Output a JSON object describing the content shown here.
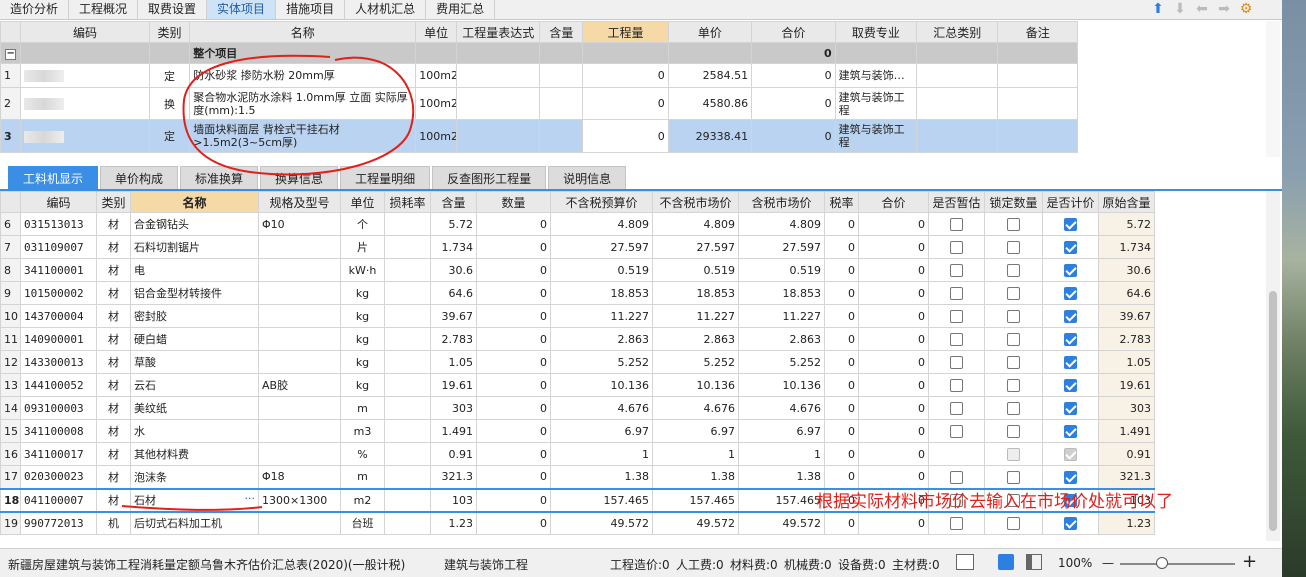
{
  "top_tabs": [
    "造价分析",
    "工程概况",
    "取费设置",
    "实体项目",
    "措施项目",
    "人材机汇总",
    "费用汇总"
  ],
  "top_active_tab": 3,
  "upper_table": {
    "headers": [
      "编码",
      "类别",
      "名称",
      "单位",
      "工程量表达式",
      "含量",
      "工程量",
      "单价",
      "合价",
      "取费专业",
      "汇总类别",
      "备注"
    ],
    "group_row": {
      "name": "整个项目",
      "total": "0"
    },
    "rows": [
      {
        "no": "1",
        "type": "定",
        "name": "防水砂浆 掺防水粉 20mm厚",
        "unit": "100m2",
        "qty": "0",
        "price": "2584.51",
        "amount": "0",
        "fee": "建筑与装饰…"
      },
      {
        "no": "2",
        "type": "换",
        "name": "聚合物水泥防水涂料 1.0mm厚 立面 实际厚度(mm):1.5",
        "unit": "100m2",
        "qty": "0",
        "price": "4580.86",
        "amount": "0",
        "fee": "建筑与装饰工程"
      },
      {
        "no": "3",
        "type": "定",
        "name": "墙面块料面层 背栓式干挂石材 >1.5m2(3~5cm厚)",
        "unit": "100m2",
        "qty": "0",
        "price": "29338.41",
        "amount": "0",
        "fee": "建筑与装饰工程"
      }
    ]
  },
  "lower_tabs": [
    "工料机显示",
    "单价构成",
    "标准换算",
    "换算信息",
    "工程量明细",
    "反查图形工程量",
    "说明信息"
  ],
  "lower_active_tab": 0,
  "lower_table": {
    "headers": [
      "编码",
      "类别",
      "名称",
      "规格及型号",
      "单位",
      "损耗率",
      "含量",
      "数量",
      "不含税预算价",
      "不含税市场价",
      "含税市场价",
      "税率",
      "合价",
      "是否暂估",
      "锁定数量",
      "是否计价",
      "原始含量"
    ],
    "rows": [
      {
        "no": "6",
        "code": "031513013",
        "type": "材",
        "name": "合金钢钻头",
        "spec": "Φ10",
        "unit": "个",
        "content": "5.72",
        "qty": "0",
        "budget": "4.809",
        "market": "4.809",
        "taxed": "4.809",
        "rate": "0",
        "amount": "0",
        "est": false,
        "lock": false,
        "price": true,
        "lockdis": false,
        "orig": "5.72"
      },
      {
        "no": "7",
        "code": "031109007",
        "type": "材",
        "name": "石料切割锯片",
        "spec": "",
        "unit": "片",
        "content": "1.734",
        "qty": "0",
        "budget": "27.597",
        "market": "27.597",
        "taxed": "27.597",
        "rate": "0",
        "amount": "0",
        "est": false,
        "lock": false,
        "price": true,
        "lockdis": false,
        "orig": "1.734"
      },
      {
        "no": "8",
        "code": "341100001",
        "type": "材",
        "name": "电",
        "spec": "",
        "unit": "kW·h",
        "content": "30.6",
        "qty": "0",
        "budget": "0.519",
        "market": "0.519",
        "taxed": "0.519",
        "rate": "0",
        "amount": "0",
        "est": false,
        "lock": false,
        "price": true,
        "lockdis": false,
        "orig": "30.6"
      },
      {
        "no": "9",
        "code": "101500002",
        "type": "材",
        "name": "铝合金型材转接件",
        "spec": "",
        "unit": "kg",
        "content": "64.6",
        "qty": "0",
        "budget": "18.853",
        "market": "18.853",
        "taxed": "18.853",
        "rate": "0",
        "amount": "0",
        "est": false,
        "lock": false,
        "price": true,
        "lockdis": false,
        "orig": "64.6"
      },
      {
        "no": "10",
        "code": "143700004",
        "type": "材",
        "name": "密封胶",
        "spec": "",
        "unit": "kg",
        "content": "39.67",
        "qty": "0",
        "budget": "11.227",
        "market": "11.227",
        "taxed": "11.227",
        "rate": "0",
        "amount": "0",
        "est": false,
        "lock": false,
        "price": true,
        "lockdis": false,
        "orig": "39.67"
      },
      {
        "no": "11",
        "code": "140900001",
        "type": "材",
        "name": "硬白蜡",
        "spec": "",
        "unit": "kg",
        "content": "2.783",
        "qty": "0",
        "budget": "2.863",
        "market": "2.863",
        "taxed": "2.863",
        "rate": "0",
        "amount": "0",
        "est": false,
        "lock": false,
        "price": true,
        "lockdis": false,
        "orig": "2.783"
      },
      {
        "no": "12",
        "code": "143300013",
        "type": "材",
        "name": "草酸",
        "spec": "",
        "unit": "kg",
        "content": "1.05",
        "qty": "0",
        "budget": "5.252",
        "market": "5.252",
        "taxed": "5.252",
        "rate": "0",
        "amount": "0",
        "est": false,
        "lock": false,
        "price": true,
        "lockdis": false,
        "orig": "1.05"
      },
      {
        "no": "13",
        "code": "144100052",
        "type": "材",
        "name": "云石",
        "spec": "AB胶",
        "unit": "kg",
        "content": "19.61",
        "qty": "0",
        "budget": "10.136",
        "market": "10.136",
        "taxed": "10.136",
        "rate": "0",
        "amount": "0",
        "est": false,
        "lock": false,
        "price": true,
        "lockdis": false,
        "orig": "19.61"
      },
      {
        "no": "14",
        "code": "093100003",
        "type": "材",
        "name": "美纹纸",
        "spec": "",
        "unit": "m",
        "content": "303",
        "qty": "0",
        "budget": "4.676",
        "market": "4.676",
        "taxed": "4.676",
        "rate": "0",
        "amount": "0",
        "est": false,
        "lock": false,
        "price": true,
        "lockdis": false,
        "orig": "303"
      },
      {
        "no": "15",
        "code": "341100008",
        "type": "材",
        "name": "水",
        "spec": "",
        "unit": "m3",
        "content": "1.491",
        "qty": "0",
        "budget": "6.97",
        "market": "6.97",
        "taxed": "6.97",
        "rate": "0",
        "amount": "0",
        "est": false,
        "lock": false,
        "price": true,
        "lockdis": false,
        "orig": "1.491"
      },
      {
        "no": "16",
        "code": "341100017",
        "type": "材",
        "name": "其他材料费",
        "spec": "",
        "unit": "%",
        "content": "0.91",
        "qty": "0",
        "budget": "1",
        "market": "1",
        "taxed": "1",
        "rate": "0",
        "amount": "0",
        "est": null,
        "lock": false,
        "price": true,
        "lockdis": true,
        "orig": "0.91"
      },
      {
        "no": "17",
        "code": "020300023",
        "type": "材",
        "name": "泡沫条",
        "spec": "Φ18",
        "unit": "m",
        "content": "321.3",
        "qty": "0",
        "budget": "1.38",
        "market": "1.38",
        "taxed": "1.38",
        "rate": "0",
        "amount": "0",
        "est": false,
        "lock": false,
        "price": true,
        "lockdis": false,
        "orig": "321.3"
      },
      {
        "no": "18",
        "code": "041100007",
        "type": "材",
        "name": "石材",
        "spec": "1300×1300",
        "unit": "m2",
        "content": "103",
        "qty": "0",
        "budget": "157.465",
        "market": "157.465",
        "taxed": "157.465",
        "rate": "0",
        "amount": "0",
        "est": false,
        "lock": false,
        "price": true,
        "lockdis": false,
        "orig": "103",
        "selected": true
      },
      {
        "no": "19",
        "code": "990772013",
        "type": "机",
        "name": "后切式石料加工机",
        "spec": "",
        "unit": "台班",
        "content": "1.23",
        "qty": "0",
        "budget": "49.572",
        "market": "49.572",
        "taxed": "49.572",
        "rate": "0",
        "amount": "0",
        "est": false,
        "lock": false,
        "price": true,
        "lockdis": false,
        "orig": "1.23"
      }
    ]
  },
  "annotation": "根据实际材料市场价去输入在市场价处就可以了",
  "status_bar": {
    "project": "新疆房屋建筑与装饰工程消耗量定额乌鲁木齐估价汇总表(2020)(一般计税)",
    "discipline": "建筑与装饰工程",
    "cost": "工程造价:0",
    "labor": "人工费:0",
    "material": "材料费:0",
    "machine": "机械费:0",
    "equipment": "设备费:0",
    "main_material": "主材费:0",
    "zoom": "100%",
    "zoom_minus": "—",
    "zoom_plus": "+"
  },
  "colors": {
    "accent": "#3a8ee6",
    "annotation": "#e0201a",
    "selected_row": "#b9d3f0"
  }
}
